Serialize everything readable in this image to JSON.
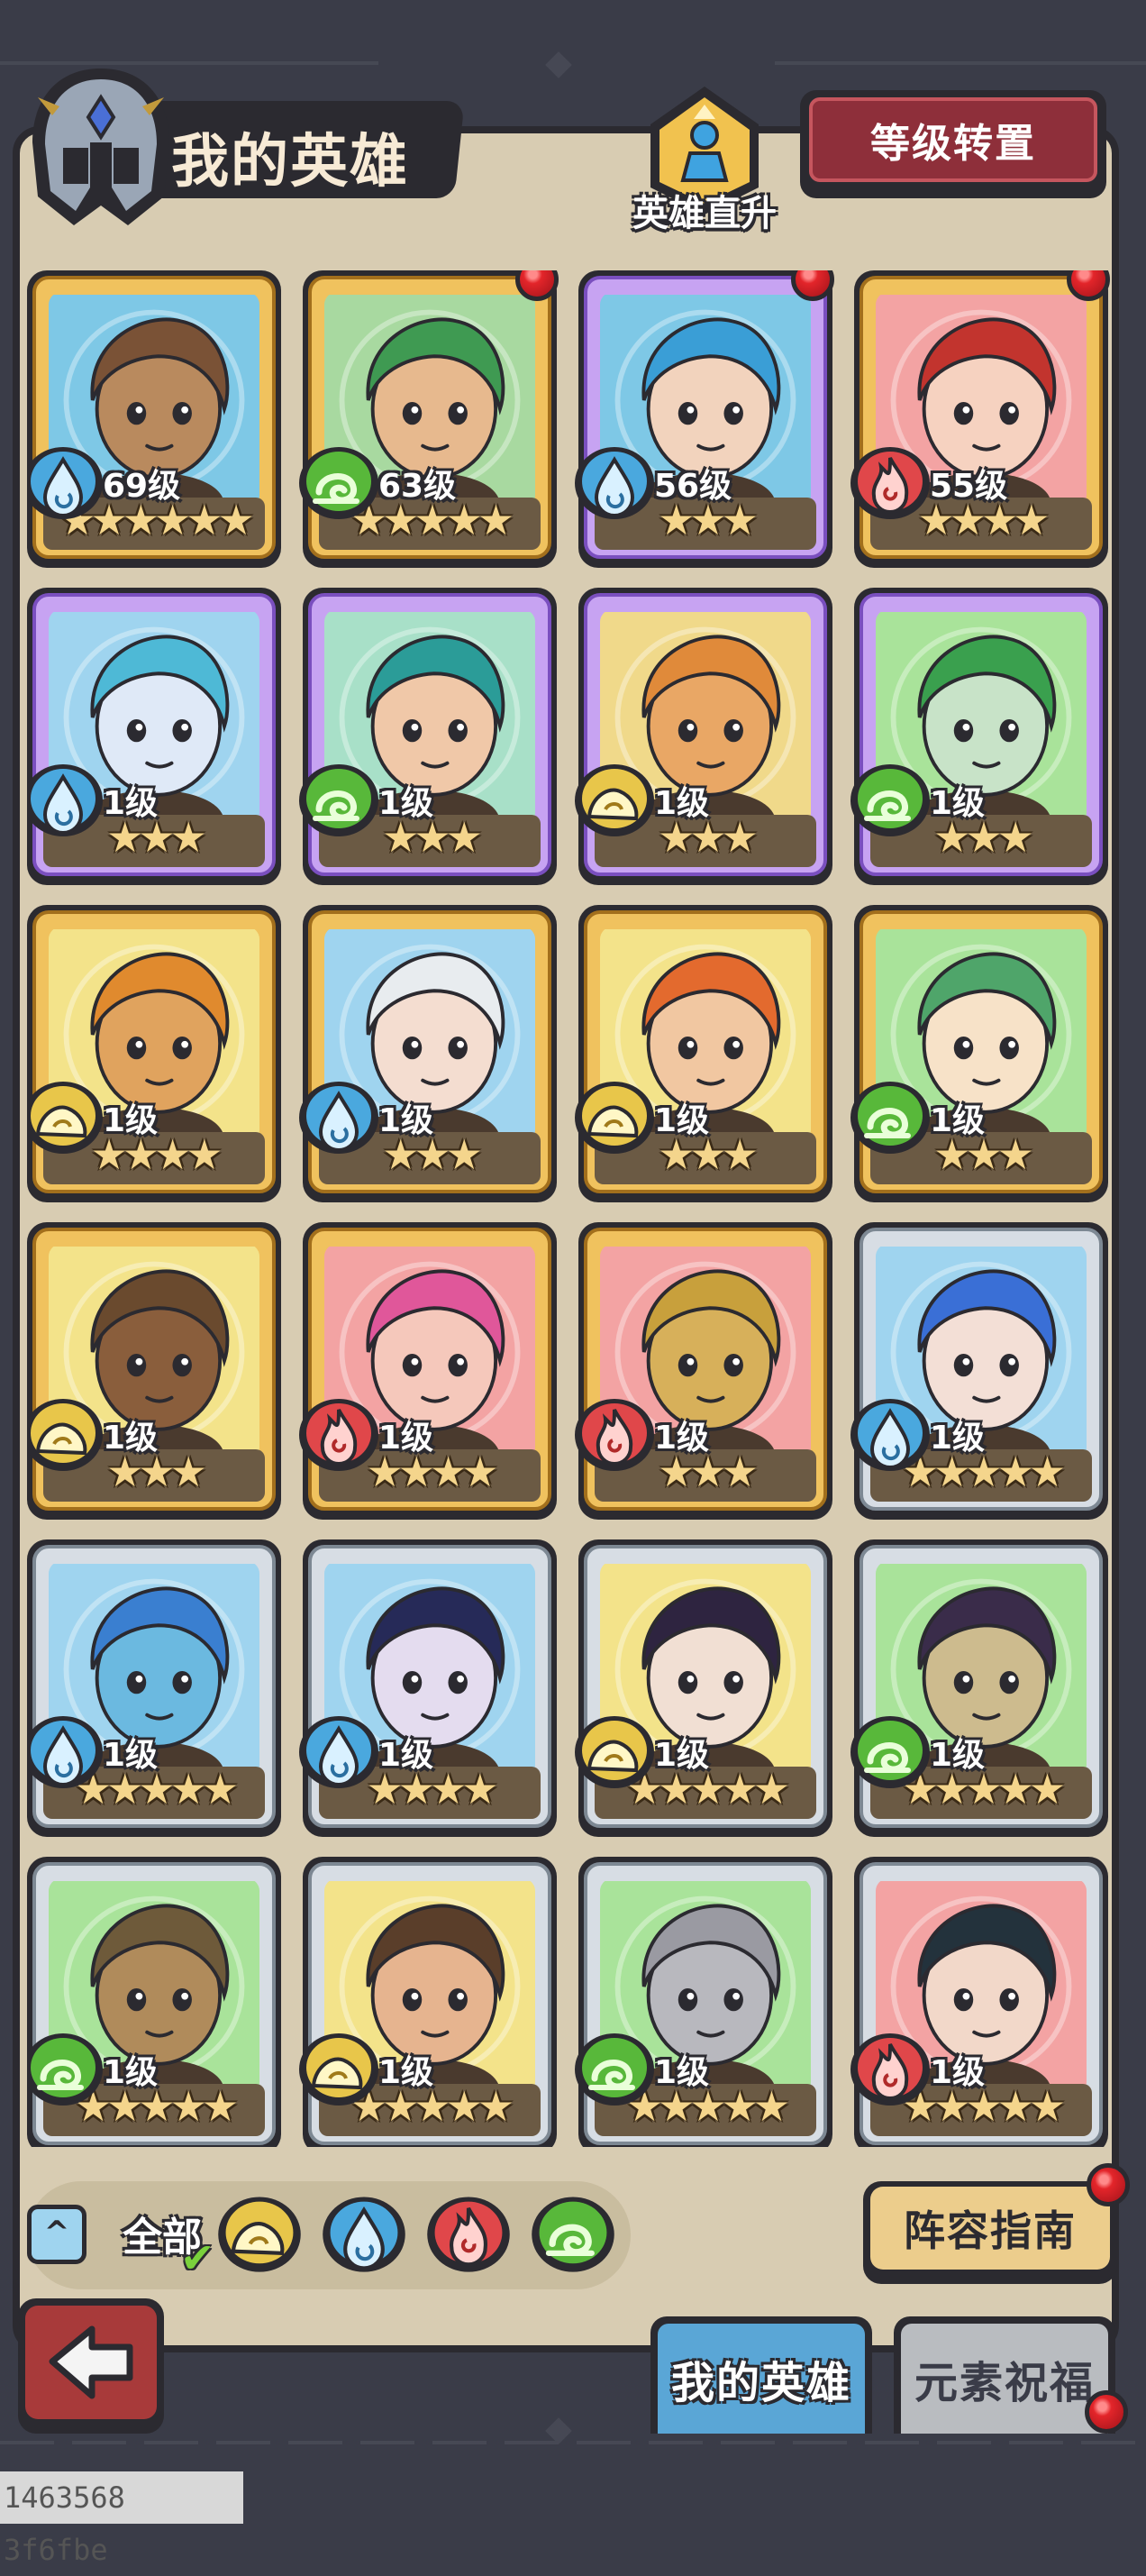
{
  "header": {
    "title": "我的英雄",
    "promo_label": "英雄直升",
    "transfer_button": "等级转置"
  },
  "colors": {
    "panel": "#d8ccb2",
    "gold_frame": "#f0c25e",
    "purple_frame": "#c7a3f2",
    "silver_frame": "#d7dde4",
    "water": "#4aa8de",
    "wind": "#58b83a",
    "fire": "#e0474a",
    "earth": "#e8c64a",
    "notify_red": "#e3252a"
  },
  "heroes": [
    {
      "level": "69级",
      "stars": "★★★★★★",
      "element": "water-element-icon",
      "frame": "gold",
      "notify": false
    },
    {
      "level": "63级",
      "stars": "★★★★★",
      "element": "wind-element-icon",
      "frame": "gold",
      "notify": true
    },
    {
      "level": "56级",
      "stars": "★★★",
      "element": "water-element-icon",
      "frame": "purple",
      "notify": true
    },
    {
      "level": "55级",
      "stars": "★★★★",
      "element": "fire-element-icon",
      "frame": "gold",
      "notify": true
    },
    {
      "level": "1级",
      "stars": "★★★",
      "element": "water-element-icon",
      "frame": "purple",
      "notify": false
    },
    {
      "level": "1级",
      "stars": "★★★",
      "element": "wind-element-icon",
      "frame": "purple",
      "notify": false
    },
    {
      "level": "1级",
      "stars": "★★★",
      "element": "earth-element-icon",
      "frame": "purple",
      "notify": false
    },
    {
      "level": "1级",
      "stars": "★★★",
      "element": "wind-element-icon",
      "frame": "purple",
      "notify": false
    },
    {
      "level": "1级",
      "stars": "★★★★",
      "element": "earth-element-icon",
      "frame": "gold",
      "notify": false
    },
    {
      "level": "1级",
      "stars": "★★★",
      "element": "water-element-icon",
      "frame": "gold",
      "notify": false
    },
    {
      "level": "1级",
      "stars": "★★★",
      "element": "earth-element-icon",
      "frame": "gold",
      "notify": false
    },
    {
      "level": "1级",
      "stars": "★★★",
      "element": "wind-element-icon",
      "frame": "gold",
      "notify": false
    },
    {
      "level": "1级",
      "stars": "★★★",
      "element": "earth-element-icon",
      "frame": "gold",
      "notify": false
    },
    {
      "level": "1级",
      "stars": "★★★★",
      "element": "fire-element-icon",
      "frame": "gold",
      "notify": false
    },
    {
      "level": "1级",
      "stars": "★★★",
      "element": "fire-element-icon",
      "frame": "gold",
      "notify": false
    },
    {
      "level": "1级",
      "stars": "★★★★★",
      "element": "water-element-icon",
      "frame": "silver",
      "notify": false
    },
    {
      "level": "1级",
      "stars": "★★★★★",
      "element": "water-element-icon",
      "frame": "silver",
      "notify": false
    },
    {
      "level": "1级",
      "stars": "★★★★",
      "element": "water-element-icon",
      "frame": "silver",
      "notify": false
    },
    {
      "level": "1级",
      "stars": "★★★★★",
      "element": "earth-element-icon",
      "frame": "silver",
      "notify": false
    },
    {
      "level": "1级",
      "stars": "★★★★★",
      "element": "wind-element-icon",
      "frame": "silver",
      "notify": false
    },
    {
      "level": "1级",
      "stars": "★★★★★",
      "element": "wind-element-icon",
      "frame": "silver",
      "notify": false
    },
    {
      "level": "1级",
      "stars": "★★★★★",
      "element": "earth-element-icon",
      "frame": "silver",
      "notify": false
    },
    {
      "level": "1级",
      "stars": "★★★★★",
      "element": "wind-element-icon",
      "frame": "silver",
      "notify": false
    },
    {
      "level": "1级",
      "stars": "★★★★★",
      "element": "fire-element-icon",
      "frame": "silver",
      "notify": false
    }
  ],
  "filters": {
    "all_label": "全部",
    "items": [
      "earth-element-icon",
      "water-element-icon",
      "fire-element-icon",
      "wind-element-icon"
    ]
  },
  "guide_button": "阵容指南",
  "tabs": [
    {
      "label": "我的英雄",
      "active": true
    },
    {
      "label": "元素祝福",
      "active": false
    }
  ],
  "watermark": "1463568 3f6fbe"
}
